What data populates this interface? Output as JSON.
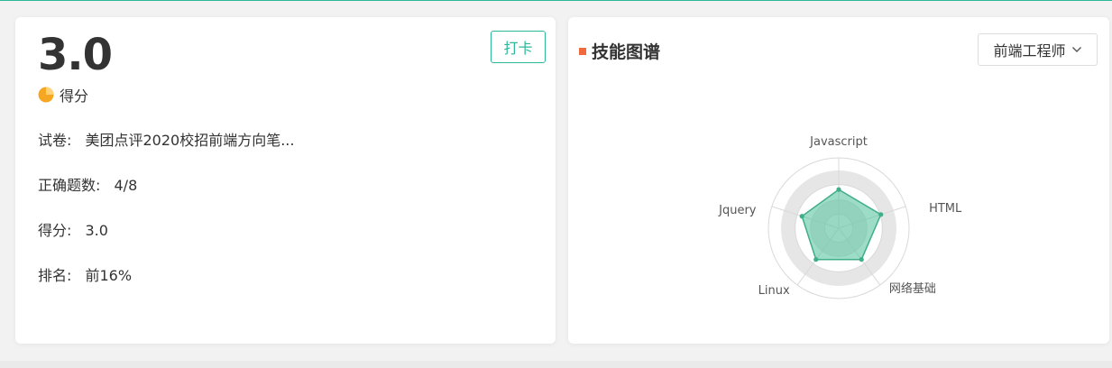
{
  "score": {
    "value": "3.0",
    "label": "得分"
  },
  "checkin": {
    "label": "打卡"
  },
  "info": {
    "paper": {
      "label": "试卷:",
      "value": "美团点评2020校招前端方向笔..."
    },
    "correct": {
      "label": "正确题数:",
      "value": "4/8"
    },
    "score": {
      "label": "得分:",
      "value": "3.0"
    },
    "rank": {
      "label": "排名:",
      "value": "前16%"
    }
  },
  "skills": {
    "title": "技能图谱",
    "role_selected": "前端工程师",
    "chart_data": {
      "type": "radar",
      "axes": [
        "Javascript",
        "HTML",
        "网络基础",
        "Linux",
        "Jquery"
      ],
      "values": [
        0.55,
        0.63,
        0.55,
        0.55,
        0.55
      ],
      "range": [
        0,
        1
      ],
      "rings": 4,
      "colors": {
        "fill": "#5cc5a2",
        "stroke": "#3fae8a",
        "band": "#e6e6e6",
        "grid": "#d9d9d9"
      }
    }
  },
  "colors": {
    "accent": "#2eb89a",
    "title_mark": "#f06a3c",
    "score_icon": "#f5a623"
  }
}
